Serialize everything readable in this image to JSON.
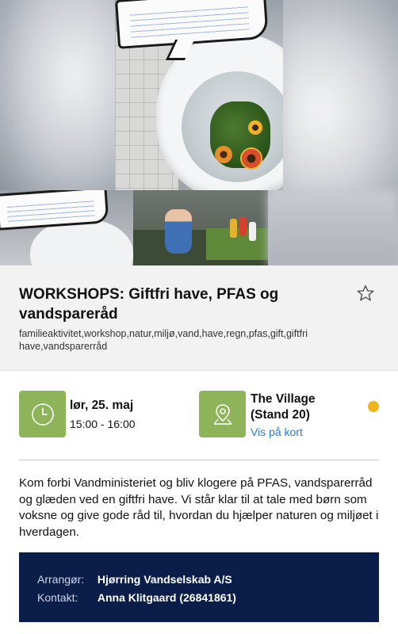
{
  "event": {
    "title": "WORKSHOPS: Giftfri have, PFAS og vandspareråd",
    "tags": "familieaktivitet,workshop,natur,miljø,vand,have,regn,pfas,gift,giftfri have,vandsparerråd",
    "favorite_icon": "star-outline-icon"
  },
  "schedule": {
    "date": "lør, 25. maj",
    "time": "15:00 - 16:00",
    "icon": "clock-icon"
  },
  "location": {
    "name": "The Village (Stand 20)",
    "map_link": "Vis på kort",
    "icon": "map-pin-icon",
    "status_color": "#f0b41c"
  },
  "description": "Kom forbi Vandministeriet og bliv klogere på PFAS, vandsparerråd og glæden ved en giftfri have. Vi står klar til at tale med børn som voksne og give gode råd til, hvordan du hjælper naturen og miljøet i hverdagen.",
  "organizer": {
    "arranger_label": "Arrangør:",
    "arranger_value": "Hjørring Vandselskab A/S",
    "contact_label": "Kontakt:",
    "contact_value": "Anna Klitgaard (26841861)"
  },
  "colors": {
    "accent_green": "#8db458",
    "link_blue": "#2b7bd0",
    "organizer_bg": "#0b1e4a"
  }
}
